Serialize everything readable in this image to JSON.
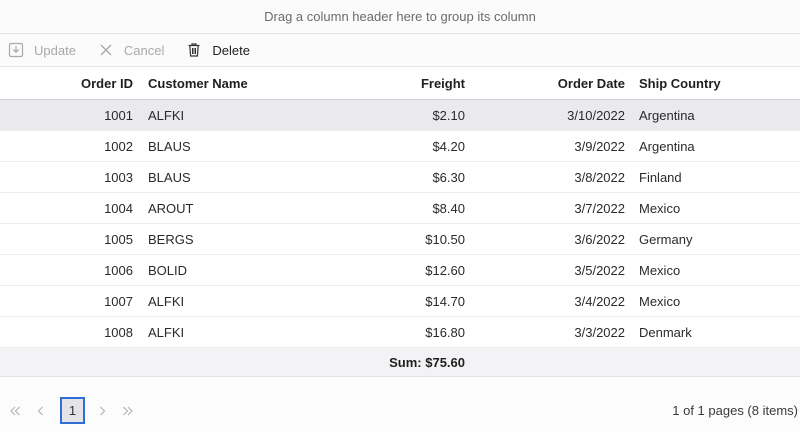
{
  "group_drop_text": "Drag a column header here to group its column",
  "toolbar": {
    "update_label": "Update",
    "cancel_label": "Cancel",
    "delete_label": "Delete"
  },
  "columns": {
    "order_id": "Order ID",
    "customer_name": "Customer Name",
    "freight": "Freight",
    "order_date": "Order Date",
    "ship_country": "Ship Country"
  },
  "rows": [
    {
      "order_id": "1001",
      "customer": "ALFKI",
      "freight": "$2.10",
      "date": "3/10/2022",
      "country": "Argentina",
      "selected": true
    },
    {
      "order_id": "1002",
      "customer": "BLAUS",
      "freight": "$4.20",
      "date": "3/9/2022",
      "country": "Argentina"
    },
    {
      "order_id": "1003",
      "customer": "BLAUS",
      "freight": "$6.30",
      "date": "3/8/2022",
      "country": "Finland"
    },
    {
      "order_id": "1004",
      "customer": "AROUT",
      "freight": "$8.40",
      "date": "3/7/2022",
      "country": "Mexico"
    },
    {
      "order_id": "1005",
      "customer": "BERGS",
      "freight": "$10.50",
      "date": "3/6/2022",
      "country": "Germany"
    },
    {
      "order_id": "1006",
      "customer": "BOLID",
      "freight": "$12.60",
      "date": "3/5/2022",
      "country": "Mexico"
    },
    {
      "order_id": "1007",
      "customer": "ALFKI",
      "freight": "$14.70",
      "date": "3/4/2022",
      "country": "Mexico"
    },
    {
      "order_id": "1008",
      "customer": "ALFKI",
      "freight": "$16.80",
      "date": "3/3/2022",
      "country": "Denmark"
    }
  ],
  "summary": {
    "freight_sum": "Sum: $75.60"
  },
  "pager": {
    "current_page": "1",
    "info": "1 of 1 pages (8 items)"
  },
  "colors": {
    "accent": "#2f6fd3",
    "selected_row": "#eaeaee"
  },
  "icons": [
    "update-icon",
    "cancel-icon",
    "delete-icon",
    "first-page-icon",
    "prev-page-icon",
    "next-page-icon",
    "last-page-icon"
  ]
}
